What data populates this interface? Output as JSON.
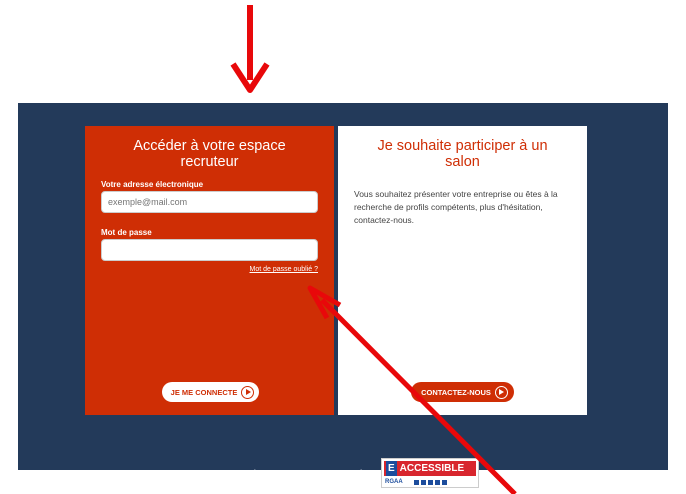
{
  "login": {
    "title": "Accéder à votre espace recruteur",
    "email_label": "Votre adresse électronique",
    "email_placeholder": "exemple@mail.com",
    "password_label": "Mot de passe",
    "forgot_link": "Mot de passe oublié ?",
    "connect_button": "JE ME CONNECTE"
  },
  "salon": {
    "title": "Je souhaite participer à un salon",
    "body": "Vous souhaitez présenter votre entreprise ou êtes à la recherche de profils compétents, plus d'hésitation, contactez-nous.",
    "contact_button": "CONTACTEZ-NOUS"
  },
  "footer": {
    "legal": "MENTIONS LÉGALES",
    "separator": "|",
    "accessibility": "ACCESSIBILITÉ"
  },
  "badge": {
    "letter": "E",
    "word": "ACCESSIBLE",
    "sub": "RGAA"
  },
  "colors": {
    "navy": "#233a5a",
    "red": "#cf2e05",
    "annotation": "#e8080a"
  },
  "icons": {
    "button_icon": "play-circle-icon",
    "annotation": "arrow-icon"
  }
}
